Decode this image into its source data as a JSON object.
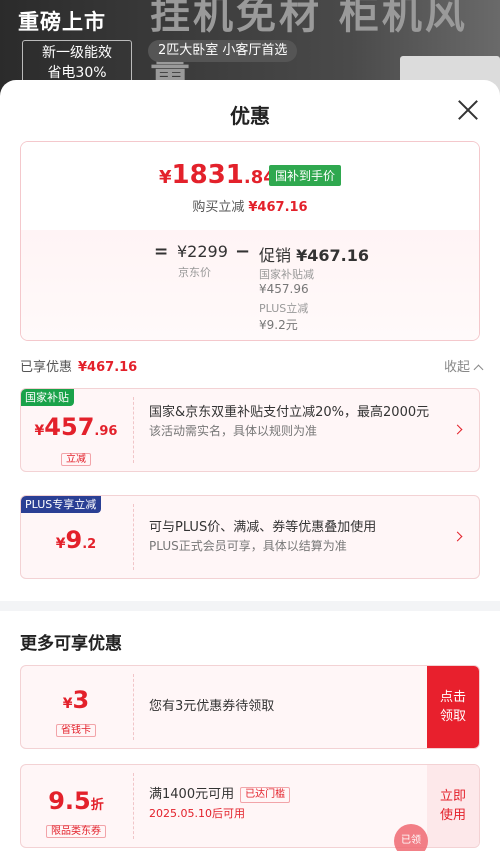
{
  "banner": {
    "title": "重磅上市",
    "big_text": "挂机免材 柜机风量",
    "energy": "新一级能效\n省电30%",
    "energy_line1": "新一级能效",
    "energy_line2": "省电30%",
    "pill": "2匹大卧室 小客厅首选"
  },
  "sheet": {
    "title": "优惠"
  },
  "summary": {
    "price_currency": "¥",
    "price_int": "1831",
    "price_dec": ".84",
    "price_tag": "国补到手价",
    "buy_cut_label": "购买立减",
    "buy_cut_value": "¥467.16",
    "equals": "=",
    "jd_price": "¥2299",
    "jd_label": "京东价",
    "minus": "−",
    "promo_label": "促销",
    "promo_value": "¥467.16",
    "gov_label": "国家补贴减",
    "gov_value": "¥457.96",
    "plus_label": "PLUS立减",
    "plus_value": "¥9.2元"
  },
  "enjoyed": {
    "label": "已享优惠",
    "value": "¥467.16",
    "collapse": "收起"
  },
  "coupons": [
    {
      "ribbon": "国家补贴",
      "ribbon_color": "#1aa24a",
      "currency": "¥",
      "int": "457",
      "dec": ".96",
      "tag": "立减",
      "desc": "国家&京东双重补贴支付立减20%，最高2000元",
      "sub": "该活动需实名，具体以规则为准"
    },
    {
      "ribbon": "PLUS专享立减",
      "ribbon_color": "#2a3f94",
      "currency": "¥",
      "int": "9",
      "dec": ".2",
      "desc": "可与PLUS价、满减、券等优惠叠加使用",
      "sub": "PLUS正式会员可享，具体以结算为准"
    }
  ],
  "more": {
    "title": "更多可享优惠",
    "items": [
      {
        "currency": "¥",
        "int": "3",
        "tag": "省钱卡",
        "desc": "您有3元优惠券待领取",
        "action": "点击领取"
      },
      {
        "int": "9.5",
        "unit": "折",
        "tag": "限品类东券",
        "desc": "满1400元可用",
        "claimed": "已达门槛",
        "date": "2025.05.10后可用",
        "action": "立即使用"
      }
    ]
  },
  "stamp": "已领"
}
